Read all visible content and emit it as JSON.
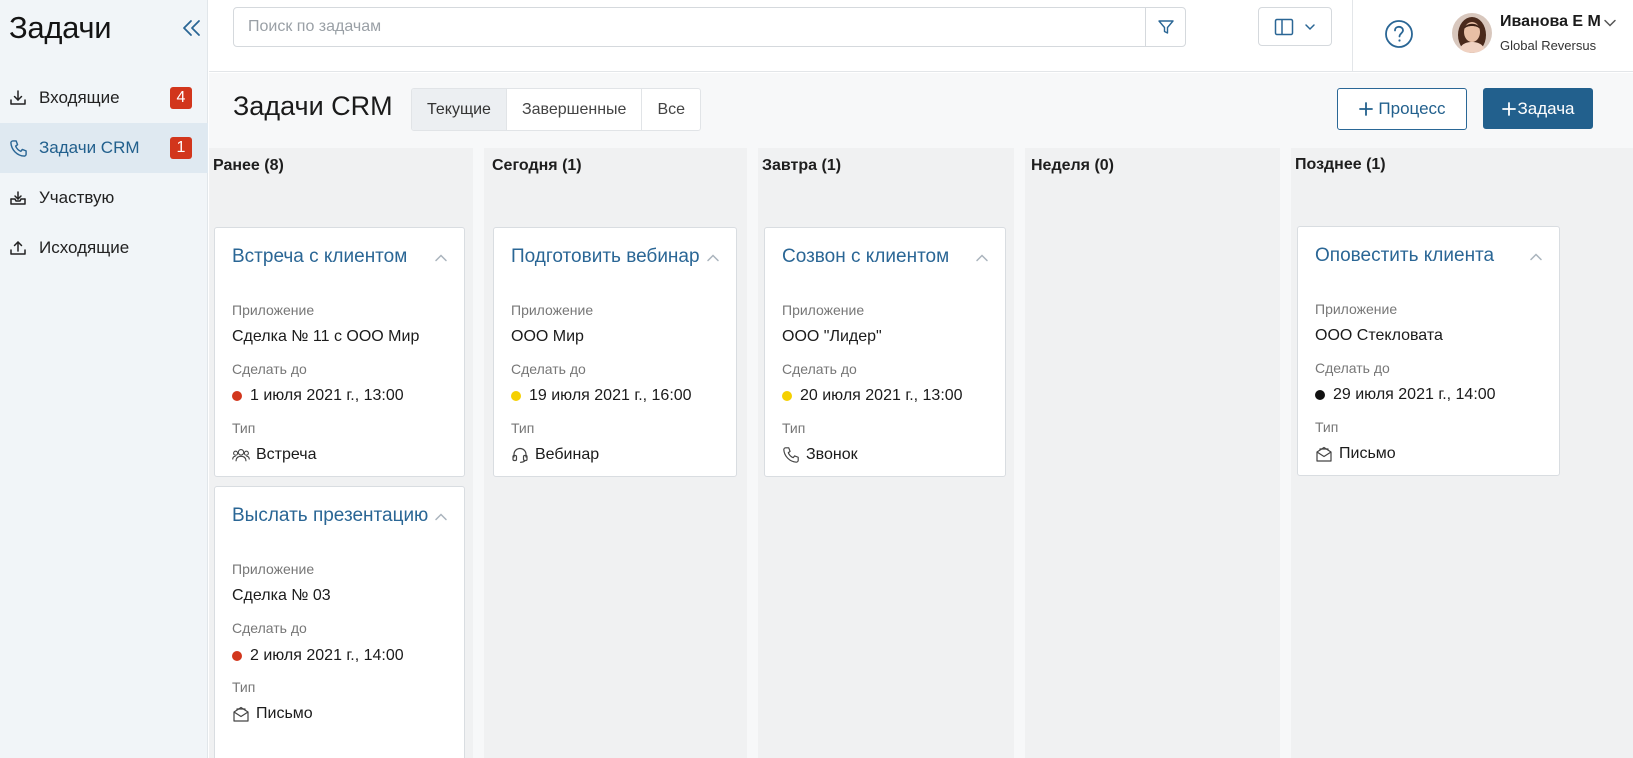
{
  "sidebar": {
    "title": "Задачи",
    "items": [
      {
        "label": "Входящие",
        "badge": "4",
        "icon": "inbox-download-icon"
      },
      {
        "label": "Задачи CRM",
        "badge": "1",
        "icon": "phone-icon"
      },
      {
        "label": "Участвую",
        "icon": "tray-icon"
      },
      {
        "label": "Исходящие",
        "icon": "upload-icon"
      }
    ]
  },
  "topbar": {
    "search_placeholder": "Поиск по задачам",
    "user_name": "Иванова Е М",
    "user_company": "Global Reversus"
  },
  "header": {
    "title": "Задачи CRM",
    "tabs": [
      "Текущие",
      "Завершенные",
      "Все"
    ],
    "active_tab": "Текущие",
    "process_button": "Процесс",
    "task_button": "Задача"
  },
  "labels": {
    "app": "Приложение",
    "due": "Сделать до",
    "type": "Тип"
  },
  "colors": {
    "overdue": "#d2361c",
    "soon": "#f5d000",
    "later": "#111111",
    "accent": "#22608d"
  },
  "columns": [
    {
      "title": "Ранее (8)",
      "cards": [
        {
          "title": "Встреча с клиентом",
          "app": "Сделка № 11 с ООО Мир",
          "due": "1 июля 2021 г., 13:00",
          "dot": "overdue",
          "type": "Встреча",
          "type_icon": "people-icon"
        },
        {
          "title": "Выслать презентацию",
          "app": "Сделка № 03",
          "due": "2 июля 2021 г., 14:00",
          "dot": "overdue",
          "type": "Письмо",
          "type_icon": "envelope-icon"
        }
      ]
    },
    {
      "title": "Сегодня (1)",
      "cards": [
        {
          "title": "Подготовить вебинар",
          "app": "ООО Мир",
          "due": "19 июля 2021 г., 16:00",
          "dot": "soon",
          "type": "Вебинар",
          "type_icon": "headset-icon"
        }
      ]
    },
    {
      "title": "Завтра (1)",
      "cards": [
        {
          "title": "Созвон с клиентом",
          "app": "ООО \"Лидер\"",
          "due": "20 июля 2021 г., 13:00",
          "dot": "soon",
          "type": "Звонок",
          "type_icon": "phone-icon"
        }
      ]
    },
    {
      "title": "Неделя (0)",
      "cards": []
    },
    {
      "title": "Позднее (1)",
      "cards": [
        {
          "title": "Оповестить клиента",
          "app": "ООО Стекловата",
          "due": "29 июля 2021 г., 14:00",
          "dot": "later",
          "type": "Письмо",
          "type_icon": "envelope-icon"
        }
      ]
    }
  ]
}
